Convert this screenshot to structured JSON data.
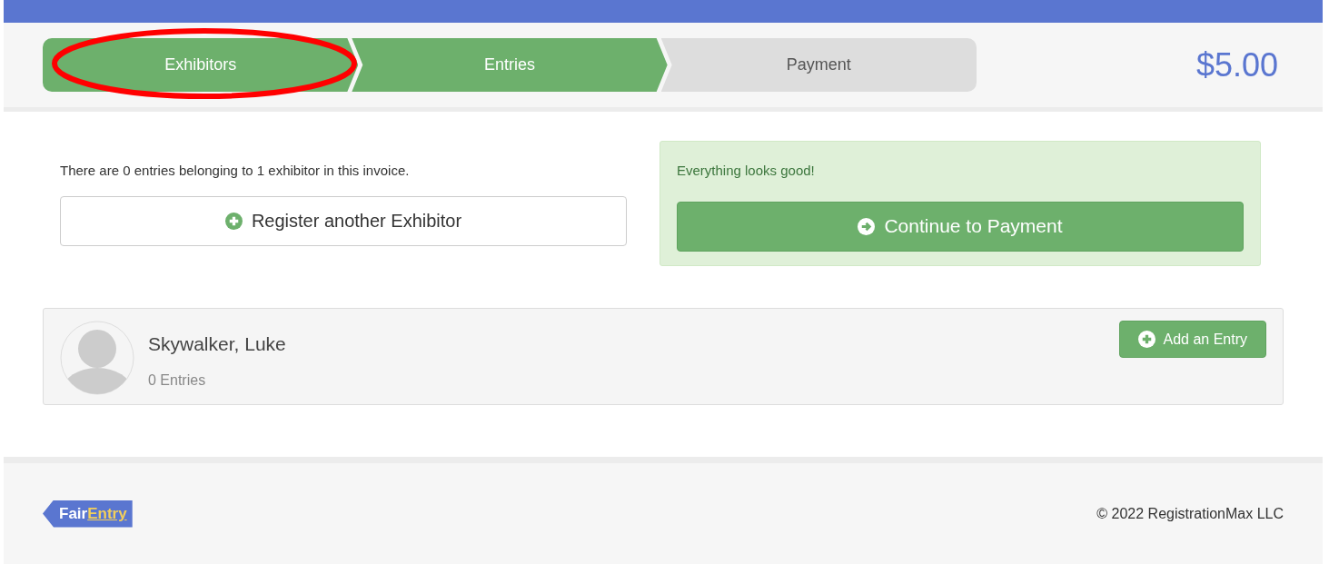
{
  "steps": [
    {
      "label": "Exhibitors",
      "done": true
    },
    {
      "label": "Entries",
      "done": true
    },
    {
      "label": "Payment",
      "done": false
    }
  ],
  "total": "$5.00",
  "summary": "There are 0 entries belonging to 1 exhibitor in this invoice.",
  "register_button": "Register another Exhibitor",
  "status_message": "Everything looks good!",
  "continue_button": "Continue to Payment",
  "exhibitors": [
    {
      "name": "Skywalker, Luke",
      "entries": "0 Entries",
      "add_button": "Add an Entry"
    }
  ],
  "footer": {
    "logo": [
      "Fair",
      "Entry"
    ],
    "copyright": "© 2022 RegistrationMax LLC"
  }
}
